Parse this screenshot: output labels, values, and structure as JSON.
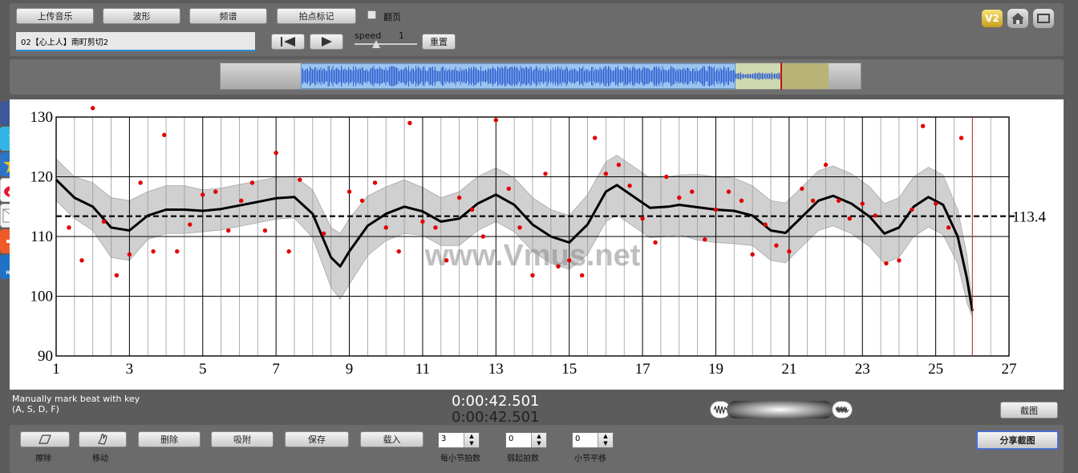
{
  "toolbar": {
    "upload_music": "上传音乐",
    "waveform": "波形",
    "spectrum": "频谱",
    "tap_mark": "拍点标记",
    "page_turn": "翻页",
    "title_field_value": "02【心上人】南町剪切2",
    "speed_label": "speed",
    "speed_value": "1",
    "reset": "重置",
    "version_badge": "V2"
  },
  "social": {
    "facebook": "f",
    "twitter": "t",
    "help": "HELP"
  },
  "chart_data": {
    "type": "scatter",
    "title": "",
    "xlabel": "",
    "ylabel": "",
    "xlim": [
      1,
      27
    ],
    "ylim": [
      90,
      130
    ],
    "x_ticks": [
      "1",
      "3",
      "5",
      "7",
      "9",
      "11",
      "13",
      "15",
      "17",
      "19",
      "21",
      "23",
      "25",
      "27"
    ],
    "y_ticks": [
      "90",
      "100",
      "110",
      "120",
      "130"
    ],
    "mean_line": 113.4,
    "mean_label": "113.4",
    "cursor_x": 26.0,
    "watermark": "www.Vmus.net",
    "points": [
      [
        1.35,
        111.5
      ],
      [
        1.7,
        106
      ],
      [
        2.0,
        131.5
      ],
      [
        2.3,
        112.5
      ],
      [
        2.65,
        103.5
      ],
      [
        3.0,
        107
      ],
      [
        3.3,
        119
      ],
      [
        3.65,
        107.5
      ],
      [
        3.95,
        127
      ],
      [
        4.3,
        107.5
      ],
      [
        4.65,
        112
      ],
      [
        5.0,
        117
      ],
      [
        5.35,
        117.5
      ],
      [
        5.7,
        111
      ],
      [
        6.05,
        116
      ],
      [
        6.35,
        119
      ],
      [
        6.7,
        111
      ],
      [
        7.0,
        124
      ],
      [
        7.35,
        107.5
      ],
      [
        7.65,
        119.5
      ],
      [
        8.3,
        110.5
      ],
      [
        9.0,
        117.5
      ],
      [
        9.35,
        116
      ],
      [
        9.7,
        119
      ],
      [
        10.0,
        111.5
      ],
      [
        10.35,
        107.5
      ],
      [
        10.65,
        129
      ],
      [
        11.0,
        112.5
      ],
      [
        11.35,
        111.5
      ],
      [
        11.65,
        106
      ],
      [
        12.0,
        116.5
      ],
      [
        12.35,
        114.5
      ],
      [
        12.65,
        110
      ],
      [
        13.0,
        129.5
      ],
      [
        13.35,
        118
      ],
      [
        13.65,
        111.5
      ],
      [
        14.0,
        103.5
      ],
      [
        14.35,
        120.5
      ],
      [
        14.7,
        105
      ],
      [
        15.0,
        106
      ],
      [
        15.35,
        103.5
      ],
      [
        15.7,
        126.5
      ],
      [
        16.0,
        120.5
      ],
      [
        16.35,
        122
      ],
      [
        16.65,
        118.5
      ],
      [
        17.0,
        113
      ],
      [
        17.35,
        109
      ],
      [
        17.65,
        120
      ],
      [
        18.0,
        116.5
      ],
      [
        18.35,
        117.5
      ],
      [
        18.7,
        109.5
      ],
      [
        19.0,
        114.5
      ],
      [
        19.35,
        117.5
      ],
      [
        19.7,
        116
      ],
      [
        20.0,
        107
      ],
      [
        20.35,
        112
      ],
      [
        20.65,
        108.5
      ],
      [
        21.0,
        107.5
      ],
      [
        21.35,
        118
      ],
      [
        21.65,
        116
      ],
      [
        22.0,
        122
      ],
      [
        22.35,
        116
      ],
      [
        22.65,
        113
      ],
      [
        23.0,
        115.5
      ],
      [
        23.35,
        113.5
      ],
      [
        23.65,
        105.5
      ],
      [
        24.0,
        106
      ],
      [
        24.35,
        114.5
      ],
      [
        24.65,
        128.5
      ],
      [
        25.0,
        115.5
      ],
      [
        25.35,
        111.5
      ],
      [
        25.7,
        126.5
      ]
    ],
    "smooth_curve": [
      [
        1.0,
        119.5
      ],
      [
        1.5,
        116.5
      ],
      [
        2.0,
        115
      ],
      [
        2.5,
        111.5
      ],
      [
        3.0,
        111
      ],
      [
        3.5,
        113.5
      ],
      [
        4.0,
        114.5
      ],
      [
        4.5,
        114.5
      ],
      [
        5.0,
        114.3
      ],
      [
        5.5,
        114.6
      ],
      [
        6.0,
        115.2
      ],
      [
        6.5,
        115.8
      ],
      [
        7.0,
        116.4
      ],
      [
        7.5,
        116.6
      ],
      [
        8.0,
        113.8
      ],
      [
        8.5,
        106.5
      ],
      [
        8.75,
        105
      ],
      [
        9.0,
        107.5
      ],
      [
        9.5,
        111.8
      ],
      [
        10.0,
        113.8
      ],
      [
        10.5,
        115
      ],
      [
        11.0,
        114.2
      ],
      [
        11.5,
        112.5
      ],
      [
        12.0,
        113
      ],
      [
        12.5,
        115.5
      ],
      [
        13.0,
        117
      ],
      [
        13.5,
        115.3
      ],
      [
        14.0,
        112
      ],
      [
        14.5,
        110
      ],
      [
        15.0,
        109
      ],
      [
        15.5,
        112
      ],
      [
        16.0,
        117.5
      ],
      [
        16.3,
        118.6
      ],
      [
        16.8,
        116.5
      ],
      [
        17.2,
        114.8
      ],
      [
        17.7,
        115
      ],
      [
        18.0,
        115.3
      ],
      [
        18.5,
        114.9
      ],
      [
        19.0,
        114.5
      ],
      [
        19.5,
        114.3
      ],
      [
        20.0,
        113.5
      ],
      [
        20.5,
        111
      ],
      [
        20.9,
        110.6
      ],
      [
        21.3,
        113
      ],
      [
        21.8,
        116
      ],
      [
        22.2,
        116.8
      ],
      [
        22.7,
        115.5
      ],
      [
        23.2,
        113.3
      ],
      [
        23.6,
        110.5
      ],
      [
        24.0,
        111.5
      ],
      [
        24.4,
        115
      ],
      [
        24.8,
        116.6
      ],
      [
        25.2,
        115.3
      ],
      [
        25.6,
        110
      ],
      [
        25.85,
        103
      ],
      [
        26.0,
        97.5
      ]
    ],
    "band_half_width": [
      3.5,
      3.5,
      4,
      5,
      5,
      4,
      4,
      4,
      3.5,
      3.5,
      3.5,
      3.5,
      3.5,
      3.5,
      4,
      5,
      5.5,
      5.5,
      5,
      4.5,
      4.5,
      4,
      4,
      4.5,
      4.5,
      4.5,
      4.5,
      4.5,
      4.5,
      4.5,
      5,
      5,
      5,
      5,
      5,
      5,
      5,
      5.5,
      5.5,
      5.5,
      5,
      5,
      5,
      5,
      5,
      5,
      5,
      5,
      5,
      5,
      5,
      5,
      5,
      4.5,
      4,
      1
    ],
    "colors": {
      "points": "#e00000",
      "curve": "#000000",
      "band": "#c8c8c8",
      "cursor": "#cc2222"
    }
  },
  "status": {
    "manual_mark_line1": "Manually mark beat with key",
    "manual_mark_line2": "(A, S, D, F)",
    "time_current": "0:00:42.501",
    "time_total": "0:00:42.501",
    "screenshot": "截图"
  },
  "bottom": {
    "erase": "擦除",
    "move": "移动",
    "delete": "删除",
    "snap": "吸附",
    "save": "保存",
    "load": "载入",
    "beats_per_bar_value": "3",
    "beats_per_bar_label": "每小节拍数",
    "pickup_beats_value": "0",
    "pickup_beats_label": "弱起拍数",
    "bar_shift_value": "0",
    "bar_shift_label": "小节平移",
    "share_screenshot": "分享截图"
  }
}
